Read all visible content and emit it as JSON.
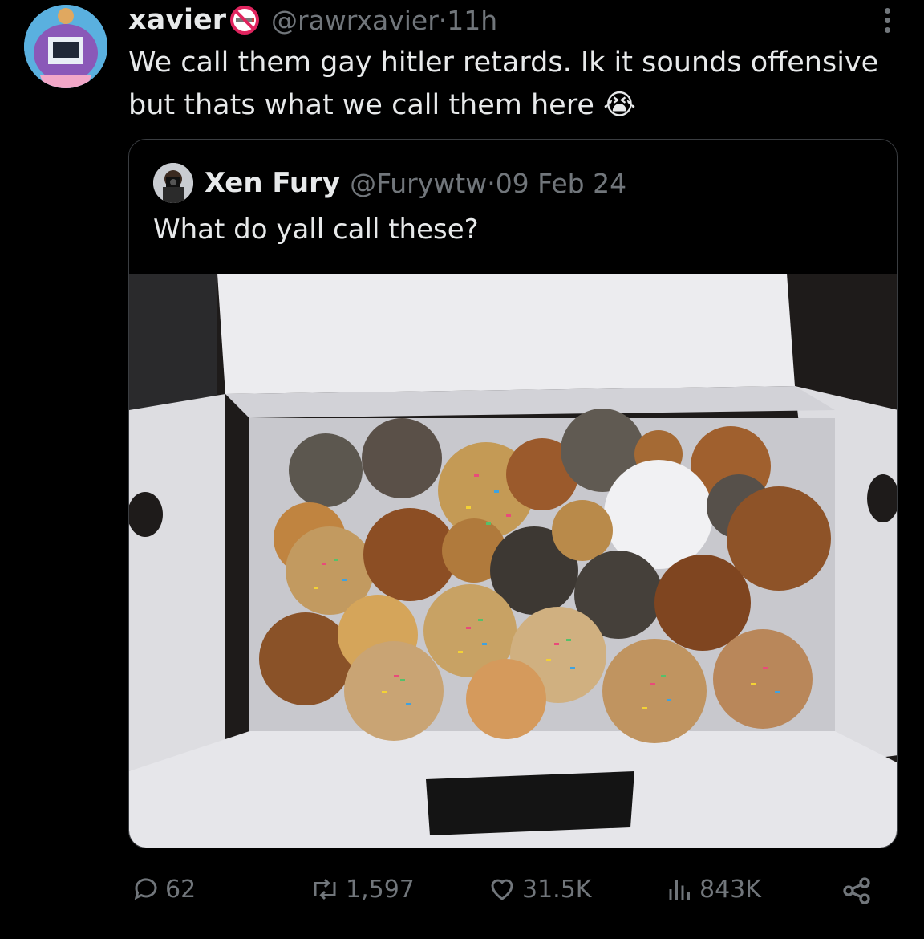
{
  "tweet": {
    "author_name": "xavier",
    "author_handle": "@rawrxavier",
    "time_sep": " · ",
    "time": "11h",
    "text": "We call them gay hitler retards. Ik it sounds offensive but thats what we call them here",
    "emoji": "😭"
  },
  "quoted_tweet": {
    "author_name": "Xen Fury",
    "author_handle": "@Furywtw",
    "time_sep": " · ",
    "date": "09 Feb 24",
    "text": "What do yall call these?"
  },
  "actions": {
    "replies": "62",
    "reposts": "1,597",
    "likes": "31.5K",
    "views": "843K"
  },
  "icons": [
    "no-smoking-icon",
    "more-icon",
    "reply-icon",
    "repost-icon",
    "like-icon",
    "views-icon",
    "share-icon"
  ],
  "colors": {
    "background": "#000000",
    "text": "#e7e9ea",
    "secondary": "#71767b",
    "border": "#3a3d41"
  }
}
